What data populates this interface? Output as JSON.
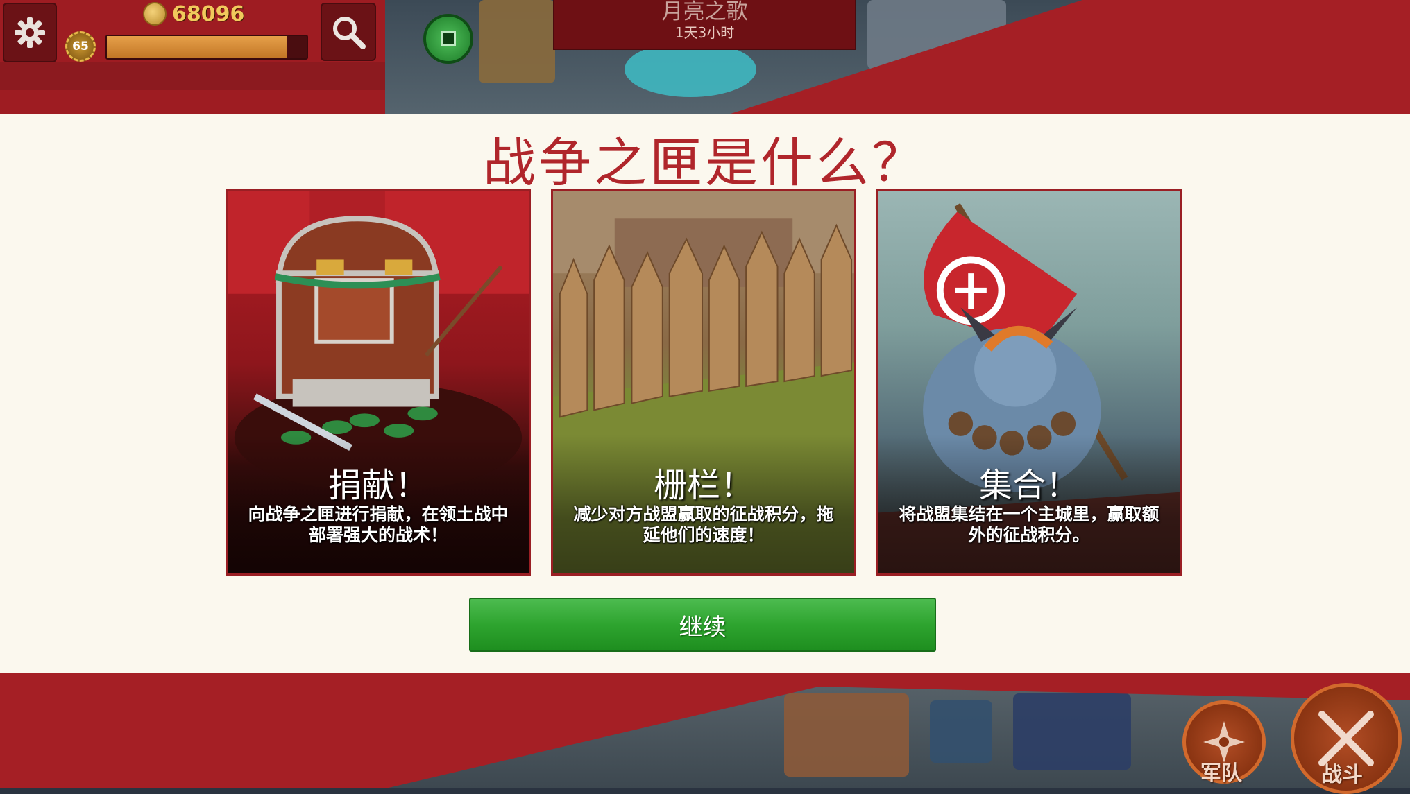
{
  "hud": {
    "coins": "68096",
    "level": "65",
    "xp_fraction": 0.9
  },
  "event": {
    "title": "月亮之歌",
    "time_left": "1天3小时"
  },
  "modal": {
    "title": "战争之匣是什么？",
    "cards": [
      {
        "heading": "捐献！",
        "description": "向战争之匣进行捐献，在领土战中部署强大的战术！",
        "art": "treasure-chest"
      },
      {
        "heading": "栅栏！",
        "description": "减少对方战盟赢取的征战积分，拖延他们的速度！",
        "art": "wooden-palisade"
      },
      {
        "heading": "集合！",
        "description": "将战盟集结在一个主城里，赢取额外的征战积分。",
        "art": "warrior-with-banner"
      }
    ],
    "continue_label": "继续"
  },
  "nav": {
    "army_label": "军队",
    "battle_label": "战斗"
  },
  "colors": {
    "banner_red": "#a51f25",
    "title_red": "#b0262b",
    "modal_bg": "#fbf8ee",
    "continue_green": "#2ea42f"
  }
}
